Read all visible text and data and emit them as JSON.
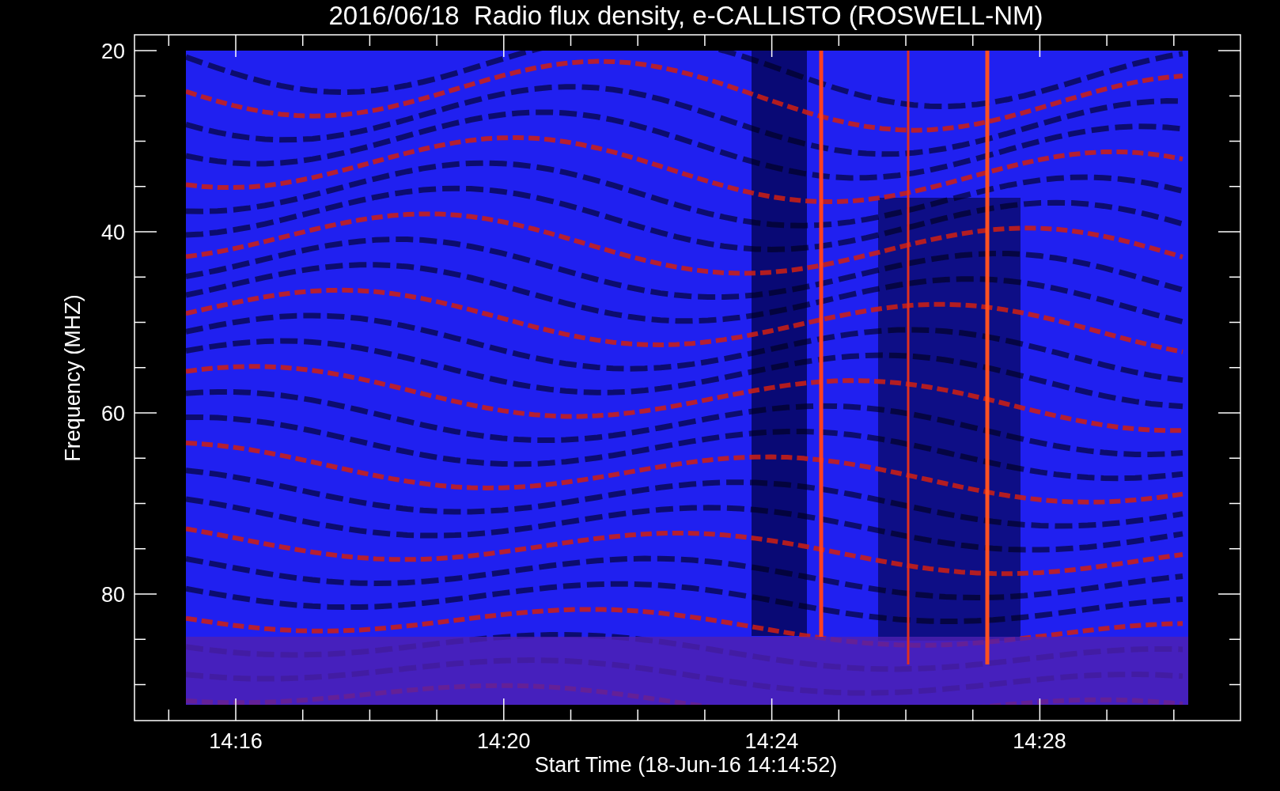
{
  "title": "2016/06/18  Radio flux density, e-CALLISTO (ROSWELL-NM)",
  "y_axis": {
    "label": "Frequency (MHZ)",
    "ticks": [
      "20",
      "40",
      "60",
      "80"
    ]
  },
  "x_axis": {
    "label": "Start Time (18-Jun-16 14:14:52)",
    "ticks": [
      "14:16",
      "14:20",
      "14:24",
      "14:28"
    ]
  }
}
